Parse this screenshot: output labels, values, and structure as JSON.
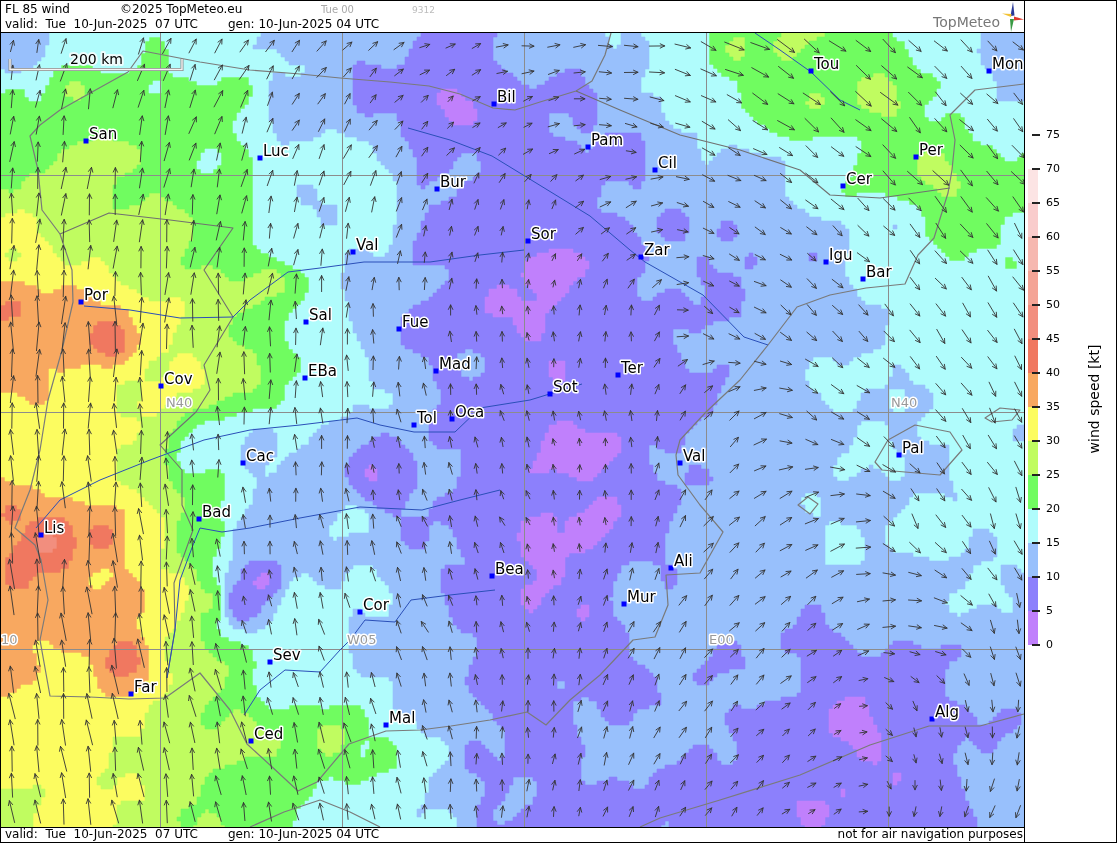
{
  "header": {
    "title": "FL 85 wind",
    "copyright": "©2025 TopMeteo.eu",
    "run": "Tue 00",
    "code": "9312",
    "valid": "valid:  Tue  10-Jun-2025  07 UTC",
    "generated": "gen: 10-Jun-2025 04 UTC",
    "logo": "TopMeteo"
  },
  "map": {
    "scale_bar": "200 km",
    "grid_labels": [
      "N40",
      "N40",
      "10",
      "W05",
      "E00"
    ],
    "cities": [
      {
        "name": "Tou"
      },
      {
        "name": "Mon"
      },
      {
        "name": "Bil"
      },
      {
        "name": "San"
      },
      {
        "name": "Luc"
      },
      {
        "name": "Pam"
      },
      {
        "name": "Cil"
      },
      {
        "name": "Per"
      },
      {
        "name": "Bur"
      },
      {
        "name": "Cer"
      },
      {
        "name": "Val"
      },
      {
        "name": "Sor"
      },
      {
        "name": "Zar"
      },
      {
        "name": "Igu"
      },
      {
        "name": "Bar"
      },
      {
        "name": "Por"
      },
      {
        "name": "Sal"
      },
      {
        "name": "Fue"
      },
      {
        "name": "Cov"
      },
      {
        "name": "EBa"
      },
      {
        "name": "Mad"
      },
      {
        "name": "Ter"
      },
      {
        "name": "Sot"
      },
      {
        "name": "Tol"
      },
      {
        "name": "Oca"
      },
      {
        "name": "Cac"
      },
      {
        "name": "Val"
      },
      {
        "name": "Pal"
      },
      {
        "name": "Lis"
      },
      {
        "name": "Bad"
      },
      {
        "name": "Bea"
      },
      {
        "name": "Ali"
      },
      {
        "name": "Cor"
      },
      {
        "name": "Mur"
      },
      {
        "name": "Sev"
      },
      {
        "name": "Far"
      },
      {
        "name": "Ced"
      },
      {
        "name": "Mal"
      },
      {
        "name": "Alg"
      }
    ]
  },
  "legend": {
    "title": "wind speed [kt]",
    "ticks": [
      "75",
      "70",
      "65",
      "60",
      "55",
      "50",
      "45",
      "40",
      "35",
      "30",
      "25",
      "20",
      "15",
      "10",
      "5",
      "0"
    ],
    "bands": [
      {
        "color": "#fce4e4"
      },
      {
        "color": "#f9cccc"
      },
      {
        "color": "#f6b8b0"
      },
      {
        "color": "#f4a496"
      },
      {
        "color": "#f28e7e"
      },
      {
        "color": "#f07860"
      },
      {
        "color": "#f8a860"
      },
      {
        "color": "#fcfc60"
      },
      {
        "color": "#c0fc60"
      },
      {
        "color": "#70fc60"
      },
      {
        "color": "#b0fcfc"
      },
      {
        "color": "#98c0fc"
      },
      {
        "color": "#8c80fc"
      },
      {
        "color": "#c080fc"
      }
    ]
  },
  "footer": {
    "valid": "valid:  Tue  10-Jun-2025  07 UTC",
    "generated": "gen: 10-Jun-2025 04 UTC",
    "disclaimer": "not for air navigation purposes"
  }
}
